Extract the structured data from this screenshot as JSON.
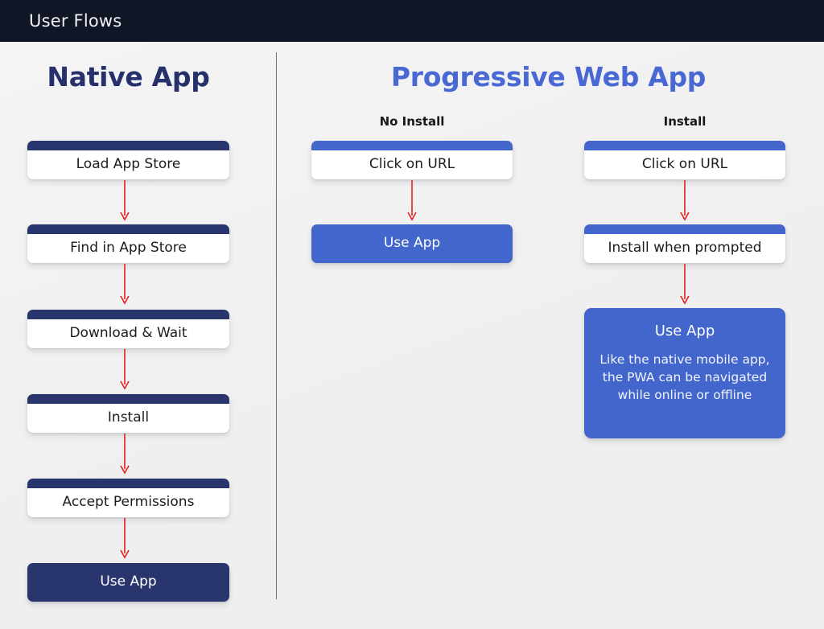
{
  "header": {
    "title": "User Flows"
  },
  "colors": {
    "header_bg": "#101626",
    "canvas_bg": "#f1f1f1",
    "navy": "#29366d",
    "blue": "#4266cc",
    "title_blue": "#4a68d4",
    "arrow_red": "#e02121",
    "divider": "#6f7380"
  },
  "columns": {
    "native": {
      "title": "Native App",
      "steps": [
        {
          "label": "Load App Store",
          "style": "outlined-navy"
        },
        {
          "label": "Find in App Store",
          "style": "outlined-navy"
        },
        {
          "label": "Download & Wait",
          "style": "outlined-navy"
        },
        {
          "label": "Install",
          "style": "outlined-navy"
        },
        {
          "label": "Accept Permissions",
          "style": "outlined-navy"
        },
        {
          "label": "Use App",
          "style": "solid-navy"
        }
      ]
    },
    "pwa": {
      "title": "Progressive Web App",
      "branches": [
        {
          "title": "No Install",
          "steps": [
            {
              "label": "Click on URL",
              "style": "outlined-blue"
            },
            {
              "label": "Use App",
              "style": "solid-blue"
            }
          ]
        },
        {
          "title": "Install",
          "steps": [
            {
              "label": "Click on URL",
              "style": "outlined-blue"
            },
            {
              "label": "Install when prompted",
              "style": "outlined-blue"
            },
            {
              "label": "Use App",
              "style": "detail-blue",
              "description": "Like the native mobile app, the PWA can be navigated while online or offline"
            }
          ]
        }
      ]
    }
  }
}
